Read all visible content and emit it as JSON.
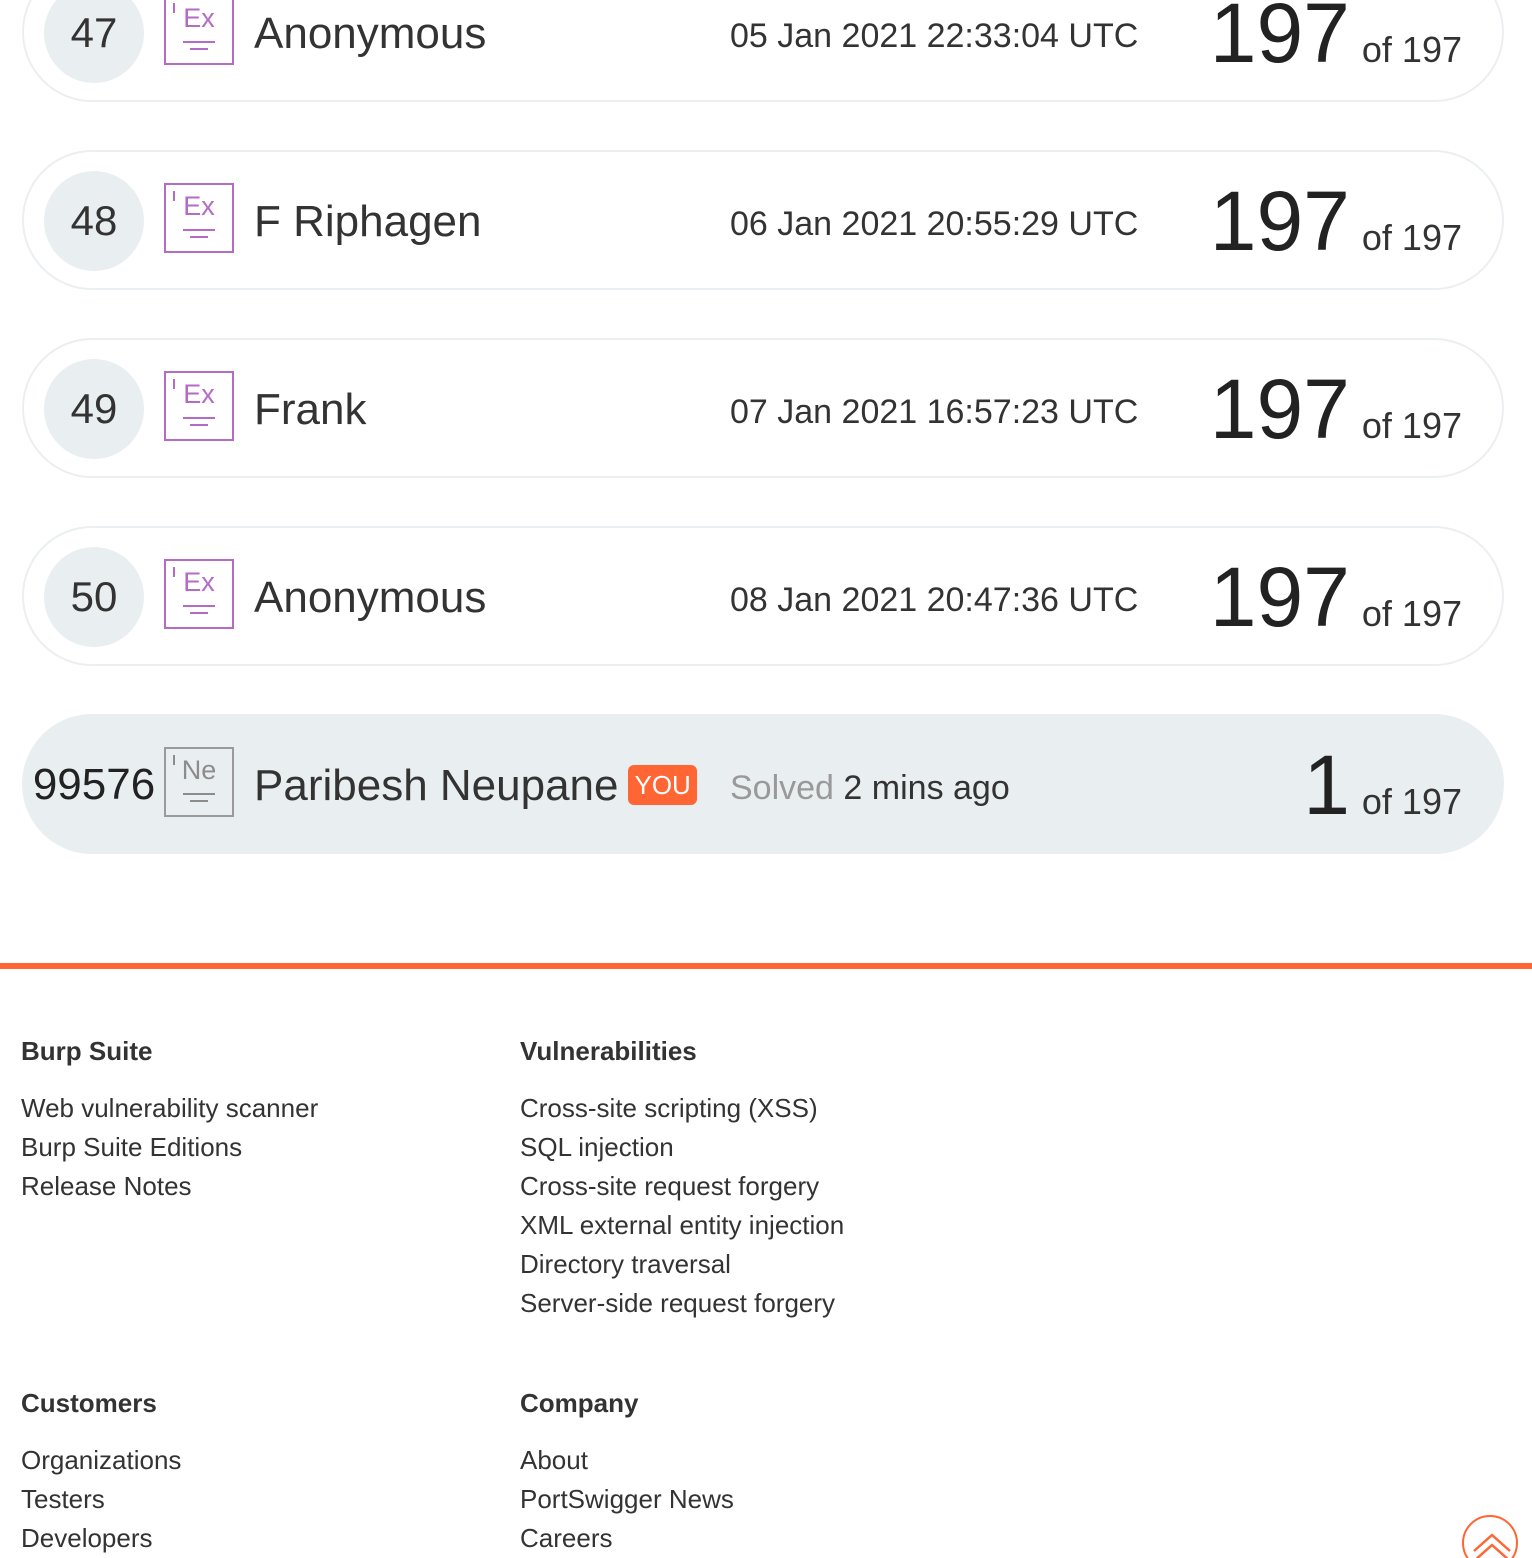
{
  "leaderboard": {
    "rows": [
      {
        "rank": "47",
        "badge": "Ex",
        "name": "Anonymous",
        "date": "05 Jan 2021 22:33:04 UTC",
        "score": "197",
        "of": "of 197"
      },
      {
        "rank": "48",
        "badge": "Ex",
        "name": "F Riphagen",
        "date": "06 Jan 2021 20:55:29 UTC",
        "score": "197",
        "of": "of 197"
      },
      {
        "rank": "49",
        "badge": "Ex",
        "name": "Frank",
        "date": "07 Jan 2021 16:57:23 UTC",
        "score": "197",
        "of": "of 197"
      },
      {
        "rank": "50",
        "badge": "Ex",
        "name": "Anonymous",
        "date": "08 Jan 2021 20:47:36 UTC",
        "score": "197",
        "of": "of 197"
      }
    ],
    "you": {
      "rank": "99576",
      "badge": "Ne",
      "name": "Paribesh Neupane",
      "tag": "YOU",
      "solved_label": "Solved",
      "solved_time": "2 mins ago",
      "score": "1",
      "of": "of 197"
    },
    "colors": {
      "expert_badge": "#b46ac7",
      "novice_badge": "#8c8c8c",
      "accent": "#ff6633"
    }
  },
  "footer": {
    "burp_suite": {
      "heading": "Burp Suite",
      "links": [
        "Web vulnerability scanner",
        "Burp Suite Editions",
        "Release Notes"
      ]
    },
    "vulnerabilities": {
      "heading": "Vulnerabilities",
      "links": [
        "Cross-site scripting (XSS)",
        "SQL injection",
        "Cross-site request forgery",
        "XML external entity injection",
        "Directory traversal",
        "Server-side request forgery"
      ]
    },
    "customers": {
      "heading": "Customers",
      "links": [
        "Organizations",
        "Testers",
        "Developers"
      ]
    },
    "company": {
      "heading": "Company",
      "links": [
        "About",
        "PortSwigger News",
        "Careers"
      ]
    },
    "back_to_top_icon": "chevron-up-icon"
  }
}
